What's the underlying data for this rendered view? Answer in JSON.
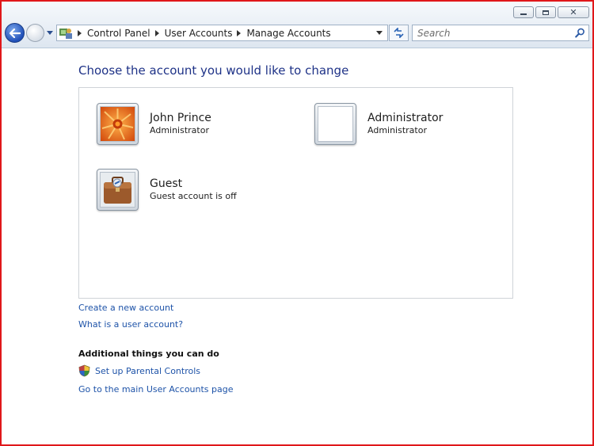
{
  "window": {
    "caption_buttons": [
      "minimize",
      "maximize",
      "close"
    ]
  },
  "navigation": {
    "back_icon": "back-arrow-icon",
    "forward_icon": "forward-arrow-icon"
  },
  "address_bar": {
    "icon": "control-panel-icon",
    "breadcrumbs": [
      "Control Panel",
      "User Accounts",
      "Manage Accounts"
    ]
  },
  "search": {
    "placeholder": "Search",
    "icon": "magnifier-icon"
  },
  "main": {
    "title": "Choose the account you would like to change",
    "accounts": [
      {
        "name": "John Prince",
        "type": "Administrator",
        "picture": "orange-flower-icon"
      },
      {
        "name": "Administrator",
        "type": "Administrator",
        "picture": "blank-picture"
      },
      {
        "name": "Guest",
        "type": "Guest account is off",
        "picture": "briefcase-icon"
      }
    ],
    "links": {
      "create_account": "Create a new account",
      "what_is_account": "What is a user account?"
    },
    "additional": {
      "heading": "Additional things you can do",
      "parental_controls": "Set up Parental Controls",
      "main_page": "Go to the main User Accounts page"
    }
  },
  "colors": {
    "link": "#1e53a8",
    "title": "#1e3287",
    "frame_border": "#e0171a"
  }
}
